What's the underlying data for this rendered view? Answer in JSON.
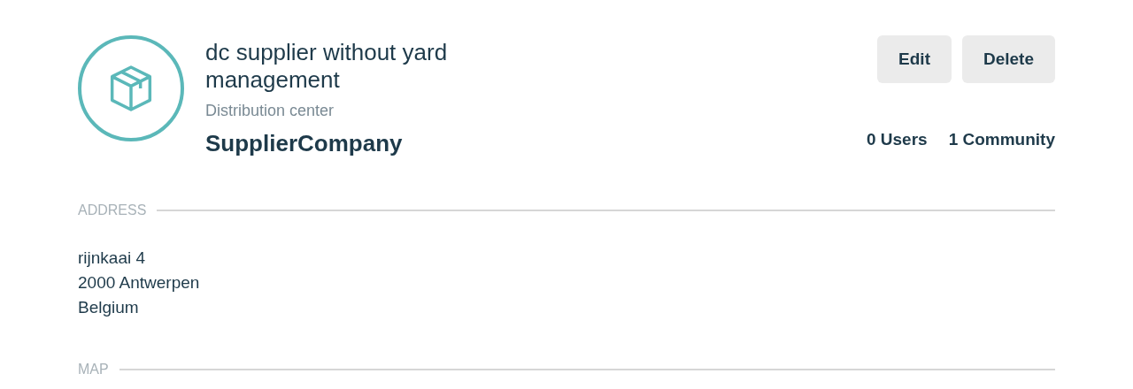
{
  "location": {
    "name": "dc supplier without yard management",
    "type": "Distribution center",
    "company": "SupplierCompany"
  },
  "buttons": [
    "Edit",
    "Delete"
  ],
  "stats": [
    "0 Users",
    "1 Community"
  ],
  "sections": [
    {
      "title": "ADDRESS",
      "lines": [
        "rijnkaai 4",
        "2000 Antwerpen",
        "Belgium"
      ]
    },
    {
      "title": "MAP"
    }
  ]
}
